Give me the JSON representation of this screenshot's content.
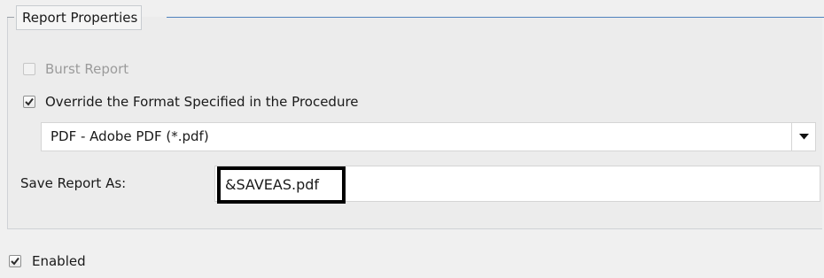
{
  "report_properties": {
    "title": "Report Properties",
    "burst_report": {
      "label": "Burst Report",
      "checked": false,
      "enabled": false
    },
    "override_format": {
      "label": "Override the Format Specified in the Procedure",
      "checked": true
    },
    "format_select": {
      "value": "PDF - Adobe PDF (*.pdf)"
    },
    "save_report_as": {
      "label": "Save Report As:",
      "value": "&SAVEAS.pdf"
    }
  },
  "enabled": {
    "label": "Enabled",
    "checked": true
  },
  "icons": {
    "check": "check-icon",
    "dropdown": "chevron-down-icon"
  }
}
